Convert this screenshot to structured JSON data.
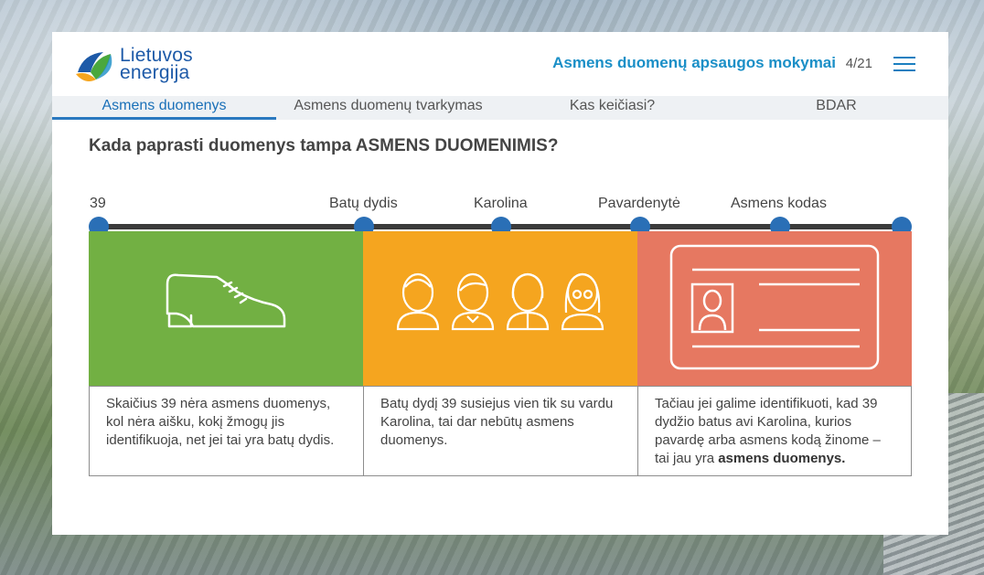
{
  "logo": {
    "line1": "Lietuvos",
    "line2": "energija"
  },
  "header": {
    "course_title": "Asmens duomenų apsaugos mokymai",
    "page_counter": "4/21",
    "menu_icon": "hamburger-icon"
  },
  "tabs": [
    {
      "label": "Asmens duomenys",
      "active": true
    },
    {
      "label": "Asmens duomenų tvarkymas",
      "active": false
    },
    {
      "label": "Kas keičiasi?",
      "active": false
    },
    {
      "label": "BDAR",
      "active": false
    }
  ],
  "question": "Kada paprasti duomenys tampa ASMENS DUOMENIMIS?",
  "timeline": {
    "labels": [
      "39",
      "Batų dydis",
      "Karolina",
      "Pavardenytė",
      "Asmens kodas"
    ]
  },
  "panels": [
    {
      "icon": "shoe-icon",
      "color": "#72b043",
      "text": "Skaičius 39 nėra asmens duomenys, kol nėra aišku, kokį žmogų jis identifikuoja, net jei tai yra batų dydis."
    },
    {
      "icon": "people-icon",
      "color": "#f5a51f",
      "text": "Batų dydį 39 susiejus vien tik su vardu Karolina, tai dar nebūtų asmens duomenys."
    },
    {
      "icon": "id-card-icon",
      "color": "#e67861",
      "text_plain": "Tačiau jei galime identifikuoti, kad 39 dydžio batus avi Karolina, kurios pavardę arba asmens kodą žinome – tai jau yra",
      "text_bold": "asmens duomenys."
    }
  ],
  "nav": {
    "prev_icon": "chevron-left-icon",
    "next_icon": "chevron-right-icon"
  },
  "colors": {
    "accent": "#1a8fc7",
    "timeline_dot": "#2a6fb6",
    "tab_active": "#2a79bf"
  }
}
